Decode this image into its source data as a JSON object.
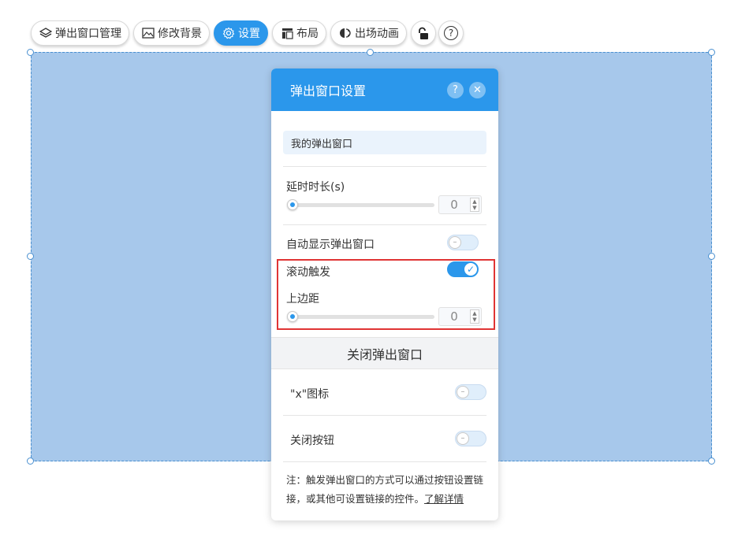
{
  "toolbar": {
    "items": [
      {
        "label": "弹出窗口管理",
        "icon": "layers-icon"
      },
      {
        "label": "修改背景",
        "icon": "image-icon"
      },
      {
        "label": "设置",
        "icon": "gear-icon",
        "active": true
      },
      {
        "label": "布局",
        "icon": "layout-icon"
      },
      {
        "label": "出场动画",
        "icon": "animation-icon"
      }
    ],
    "lock_icon": "unlock-icon",
    "help_icon": "help-icon",
    "help_glyph": "?"
  },
  "panel": {
    "title": "弹出窗口设置",
    "help_glyph": "?",
    "close_glyph": "✕",
    "name_value": "我的弹出窗口",
    "delay": {
      "label": "延时时长(s)",
      "value": "0"
    },
    "auto_show": {
      "label": "自动显示弹出窗口",
      "on": false
    },
    "scroll_trigger": {
      "label": "滚动触发",
      "on": true
    },
    "top_margin": {
      "label": "上边距",
      "value": "0"
    },
    "close_section": {
      "title": "关闭弹出窗口",
      "x_icon": {
        "label": "\"x\"图标",
        "on": false
      },
      "close_button": {
        "label": "关闭按钮",
        "on": false
      }
    },
    "note": {
      "text": "注：触发弹出窗口的方式可以通过按钮设置链接，或其他可设置链接的控件。",
      "link": "了解详情"
    }
  },
  "colors": {
    "accent": "#2b97eb",
    "canvas": "#a7c8eb",
    "highlight": "#e03434"
  }
}
